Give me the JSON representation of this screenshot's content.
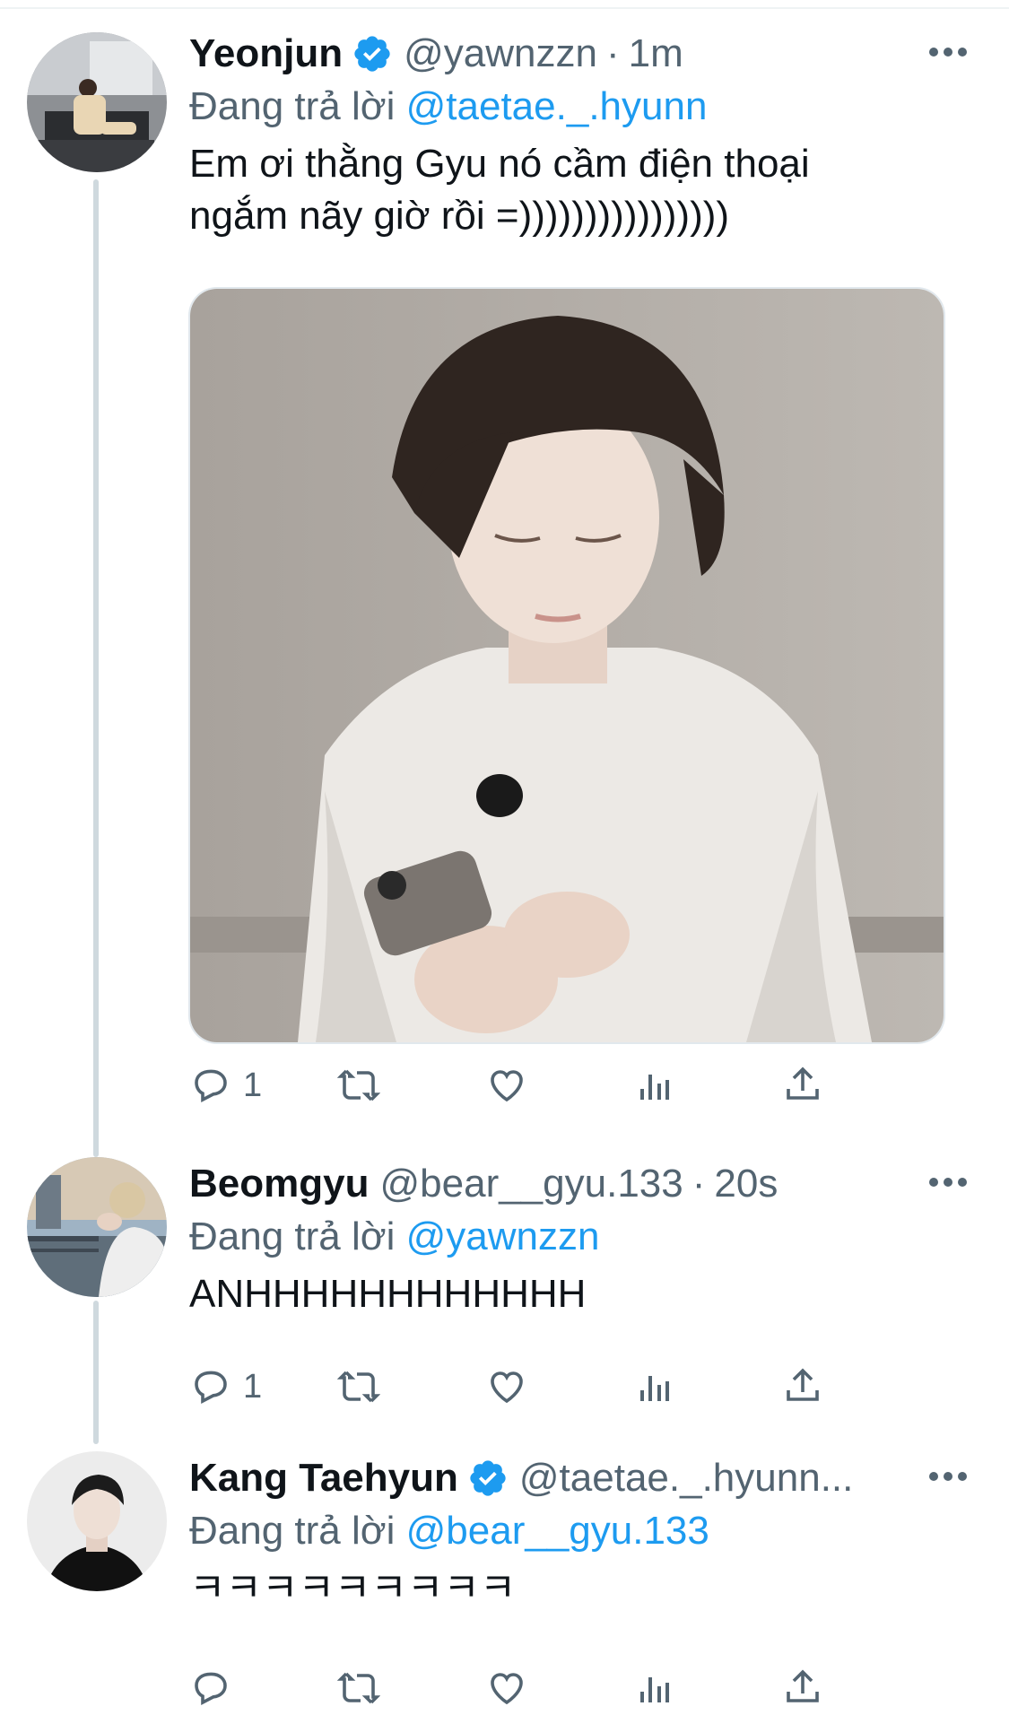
{
  "tweets": [
    {
      "name": "Yeonjun",
      "verified": true,
      "handle": "@yawnzzn",
      "dot": "·",
      "time": "1m",
      "reply_prefix": "Đang trả lời",
      "reply_to": "@taetae._.hyunn",
      "text_line1": "Em ơi thằng Gyu nó cầm điện thoại",
      "text_line2": "ngắm nãy giờ rồi =))))))))))))))))",
      "has_media": true,
      "reply_count": "1"
    },
    {
      "name": "Beomgyu",
      "verified": false,
      "handle": "@bear__gyu.133",
      "dot": "·",
      "time": "20s",
      "reply_prefix": "Đang trả lời",
      "reply_to": "@yawnzzn",
      "text_line1": "ANHHHHHHHHHHHH",
      "reply_count": "1"
    },
    {
      "name": "Kang Taehyun",
      "verified": true,
      "handle": "@taetae._.hyunn...",
      "reply_prefix": "Đang trả lời",
      "reply_to": "@bear__gyu.133",
      "text_line1": "ㅋㅋㅋㅋㅋㅋㅋㅋㅋ",
      "reply_count": ""
    }
  ],
  "colors": {
    "link": "#1d9bf0",
    "secondary_text": "#536471",
    "verified_badge": "#1d9bf0",
    "thread_line": "#cfd9de"
  },
  "icons": [
    "verified-icon",
    "more-icon",
    "reply-icon",
    "retweet-icon",
    "like-icon",
    "views-icon",
    "share-icon"
  ]
}
